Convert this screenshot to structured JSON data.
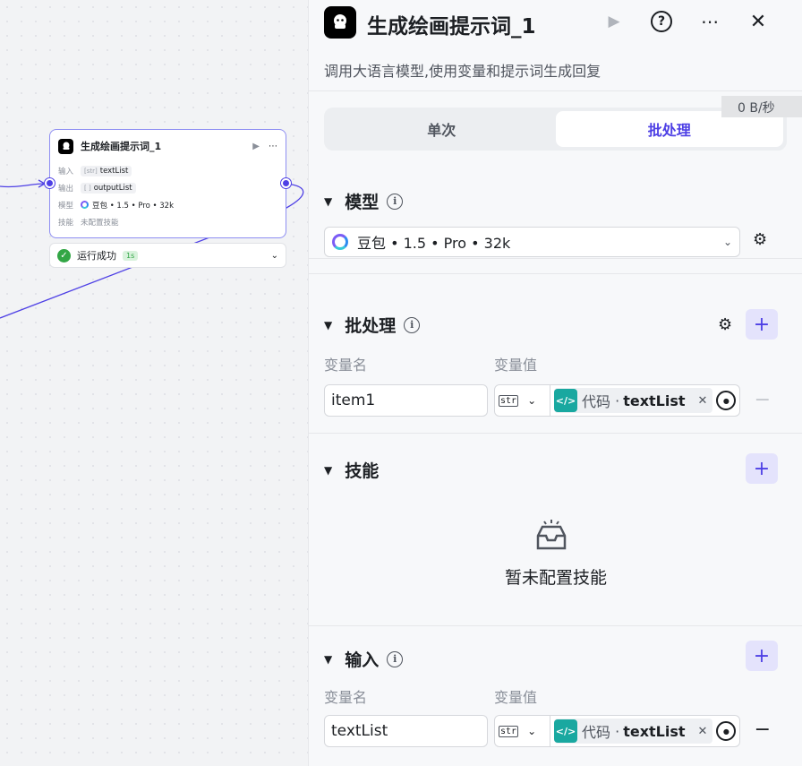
{
  "node": {
    "title": "生成绘画提示词_1",
    "rows": [
      {
        "key": "输入",
        "type_icon": "[str]",
        "value": "textList"
      },
      {
        "key": "输出",
        "type_icon": "[ ]",
        "value": "outputList"
      },
      {
        "key": "模型",
        "value": "豆包 • 1.5 • Pro • 32k"
      },
      {
        "key": "技能",
        "value": "未配置技能"
      }
    ],
    "status": {
      "text": "运行成功",
      "time": "1s"
    }
  },
  "panel": {
    "title": "生成绘画提示词_1",
    "description": "调用大语言模型,使用变量和提示词生成回复",
    "speed": "0 B/秒",
    "tabs": [
      {
        "label": "单次"
      },
      {
        "label": "批处理",
        "active": true
      }
    ],
    "model": {
      "heading": "模型",
      "selected": "豆包 • 1.5 • Pro • 32k"
    },
    "batch": {
      "heading": "批处理",
      "name_label": "变量名",
      "value_label": "变量值",
      "row": {
        "name": "item1",
        "type": "str",
        "source": "代码",
        "var": "textList"
      }
    },
    "skills": {
      "heading": "技能",
      "empty_text": "暂未配置技能"
    },
    "inputs": {
      "heading": "输入",
      "name_label": "变量名",
      "value_label": "变量值",
      "row": {
        "name": "textList",
        "type": "str",
        "source": "代码",
        "var": "textList"
      }
    }
  },
  "colors": {
    "accent": "#4e40e5",
    "success": "#32a645",
    "code": "#19a8a0"
  },
  "icons": [
    "logo-icon",
    "play-icon",
    "help-icon",
    "more-icon",
    "close-icon",
    "info-icon",
    "gear-icon",
    "add-icon",
    "chevron-down-icon",
    "code-icon",
    "variable-icon",
    "inbox-icon",
    "minus-icon"
  ]
}
